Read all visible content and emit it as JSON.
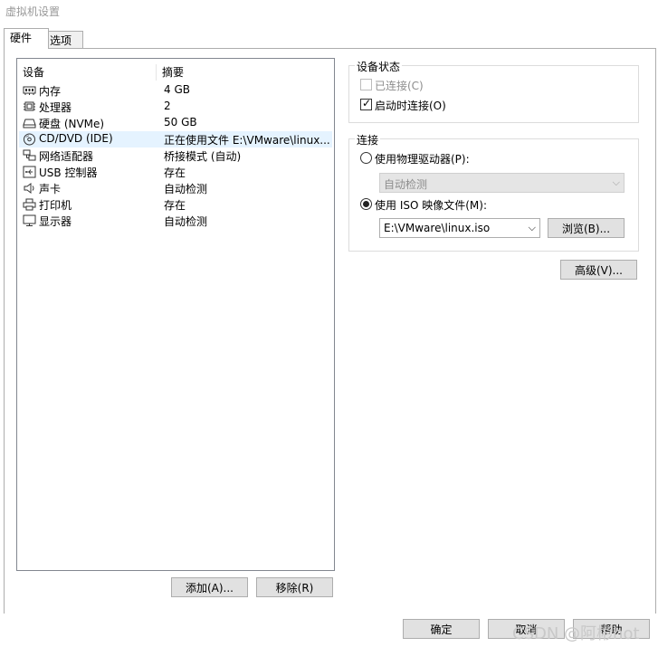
{
  "window": {
    "title": "虚拟机设置"
  },
  "tabs": [
    {
      "label": "硬件"
    },
    {
      "label": "选项"
    }
  ],
  "device_list": {
    "headers": {
      "device": "设备",
      "summary": "摘要"
    },
    "rows": [
      {
        "icon": "memory-icon",
        "name": "内存",
        "summary": "4 GB"
      },
      {
        "icon": "cpu-icon",
        "name": "处理器",
        "summary": "2"
      },
      {
        "icon": "disk-icon",
        "name": "硬盘 (NVMe)",
        "summary": "50 GB"
      },
      {
        "icon": "cd-icon",
        "name": "CD/DVD (IDE)",
        "summary": "正在使用文件 E:\\VMware\\linux...."
      },
      {
        "icon": "network-icon",
        "name": "网络适配器",
        "summary": "桥接模式 (自动)"
      },
      {
        "icon": "usb-icon",
        "name": "USB 控制器",
        "summary": "存在"
      },
      {
        "icon": "speaker-icon",
        "name": "声卡",
        "summary": "自动检测"
      },
      {
        "icon": "printer-icon",
        "name": "打印机",
        "summary": "存在"
      },
      {
        "icon": "monitor-icon",
        "name": "显示器",
        "summary": "自动检测"
      }
    ],
    "selected_index": 3
  },
  "buttons": {
    "add": "添加(A)...",
    "remove": "移除(R)",
    "browse": "浏览(B)...",
    "advanced": "高级(V)...",
    "ok": "确定",
    "cancel": "取消",
    "help": "帮助"
  },
  "device_status": {
    "title": "设备状态",
    "connected": "已连接(C)",
    "connect_on_start": "启动时连接(O)"
  },
  "connection": {
    "title": "连接",
    "physical_drive": "使用物理驱动器(P):",
    "physical_drive_value": "自动检测",
    "iso_file": "使用 ISO 映像文件(M):",
    "iso_path": "E:\\VMware\\linux.iso"
  },
  "watermark": "CSDN @阿彬hot"
}
